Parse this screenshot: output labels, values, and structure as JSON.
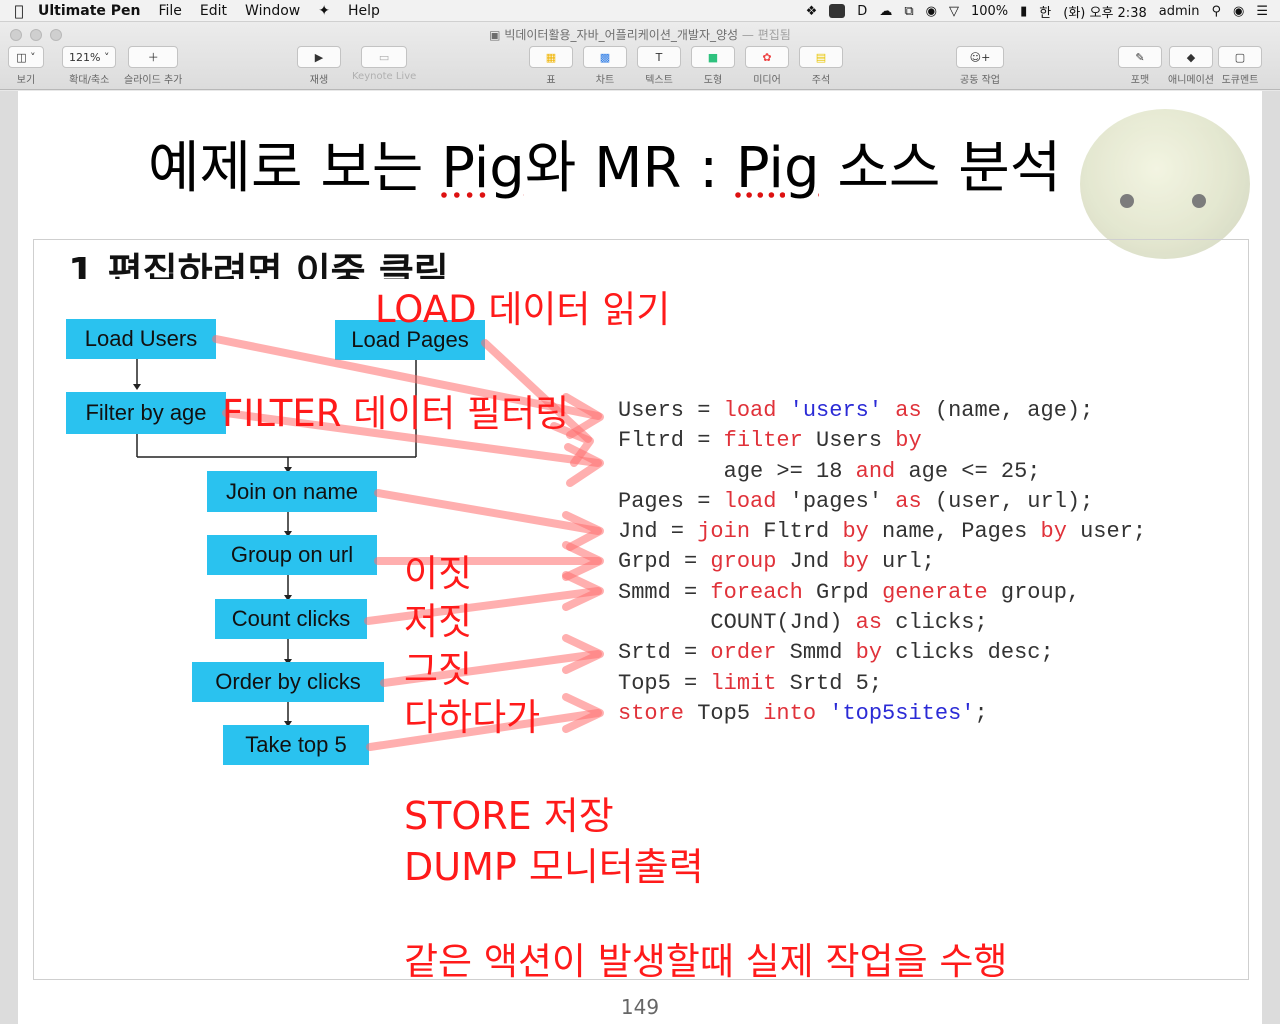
{
  "menubar": {
    "apple": "",
    "app_name": "Ultimate Pen",
    "menus": [
      "File",
      "Edit",
      "Window",
      "Help"
    ],
    "battery": "100%",
    "input_lang": "한",
    "clock": "(화) 오후 2:38",
    "user": "admin"
  },
  "window": {
    "doc_title": "빅데이터활용_자바_어플리케이션_개발자_양성",
    "doc_status": "— 편집됨"
  },
  "toolbar": {
    "view_label": "보기",
    "zoom_value": "121%",
    "zoom_label": "확대/축소",
    "add_slide_label": "슬라이드 추가",
    "play_label": "재생",
    "keynote_live_label": "Keynote Live",
    "table_label": "표",
    "chart_label": "차트",
    "text_label": "텍스트",
    "shape_label": "도형",
    "media_label": "미디어",
    "comment_label": "주석",
    "collab_label": "공동 작업",
    "format_label": "포맷",
    "animate_label": "애니메이션",
    "document_label": "도큐멘트"
  },
  "slide": {
    "title_part1": "예제로 보는 ",
    "title_pig1": "Pig",
    "title_part2": "와 MR : ",
    "title_pig2": "Pig",
    "title_part3": " 소스 분석",
    "placeholder": "1   편집하려면 이중 클릭",
    "page_number": "149",
    "flow": {
      "load_users": "Load Users",
      "load_pages": "Load Pages",
      "filter_by_age": "Filter by age",
      "join_on_name": "Join on name",
      "group_on_url": "Group on url",
      "count_clicks": "Count clicks",
      "order_by_clicks": "Order by clicks",
      "take_top5": "Take top 5"
    },
    "notes": {
      "load": "LOAD 데이터 읽기",
      "filter": "FILTER 데이터 필터링",
      "line1": "이짓",
      "line2": "저짓",
      "line3": "그짓",
      "line4": "다하다가",
      "store": "STORE  저장",
      "dump": "DUMP  모니터출력",
      "action": "같은 액션이 발생할때 실제 작업을 수행"
    },
    "colors": {
      "node": "#2ac2ef",
      "note": "#ff1a1a",
      "keyword": "#e0323a",
      "string": "#2b2bd6",
      "arrow": "#ff8a8a"
    }
  }
}
